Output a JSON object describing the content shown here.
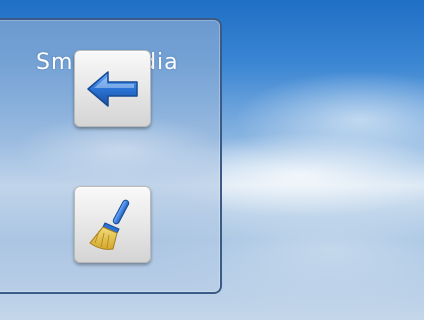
{
  "app": {
    "logo_text": "SmartMedia"
  },
  "sidebar": {
    "buttons": [
      {
        "name": "back",
        "icon": "left-arrow-icon"
      },
      {
        "name": "clear",
        "icon": "broom-icon"
      }
    ]
  },
  "colors": {
    "accent_blue": "#2a73d6",
    "panel_border": "#3c5a86",
    "broom_yellow": "#e8c64a"
  }
}
